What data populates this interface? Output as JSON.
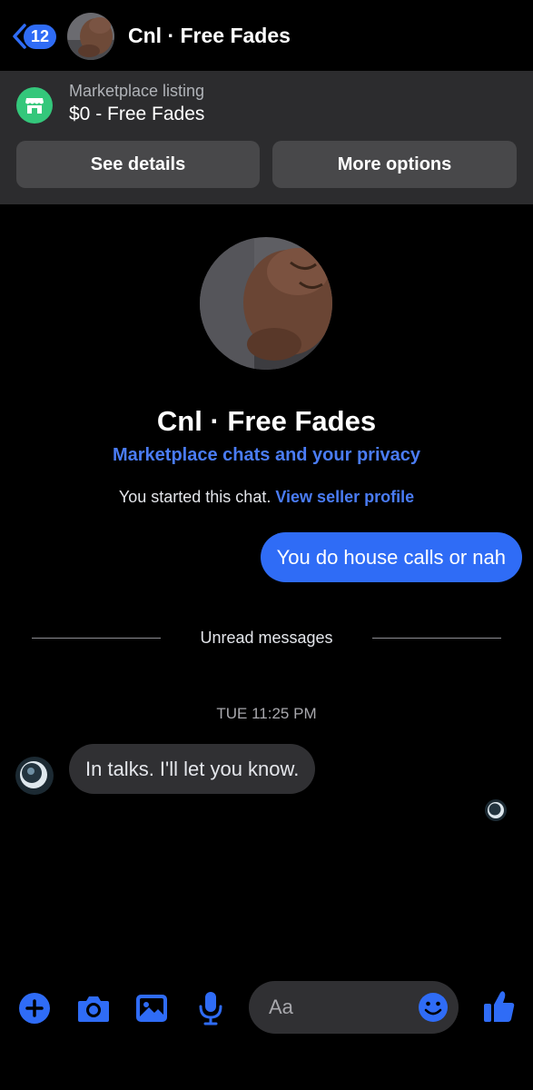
{
  "header": {
    "back_badge": "12",
    "title": "Cnl · Free Fades",
    "back_icon": "chevron-left-icon"
  },
  "listing": {
    "label": "Marketplace listing",
    "title": "$0 - Free Fades",
    "icon": "storefront-icon",
    "see_details": "See details",
    "more_options": "More options"
  },
  "profile": {
    "name": "Cnl · Free Fades",
    "privacy_link": "Marketplace chats and your privacy",
    "started_text": "You started this chat.",
    "seller_link": "View seller profile"
  },
  "messages": {
    "outgoing": "You do house calls or nah",
    "unread_label": "Unread messages",
    "timestamp": "TUE 11:25 PM",
    "incoming": "In talks. I'll let you know."
  },
  "composer": {
    "placeholder": "Aa",
    "icons": [
      "plus-icon",
      "camera-icon",
      "photo-icon",
      "microphone-icon",
      "emoji-icon",
      "thumbs-up-icon"
    ]
  },
  "colors": {
    "accent": "#2f6cf6",
    "link": "#4a7cf5",
    "banner_bg": "#2c2c2e",
    "button_bg": "#48484a",
    "store_green": "#34c77b",
    "incoming_bubble": "#303033"
  }
}
